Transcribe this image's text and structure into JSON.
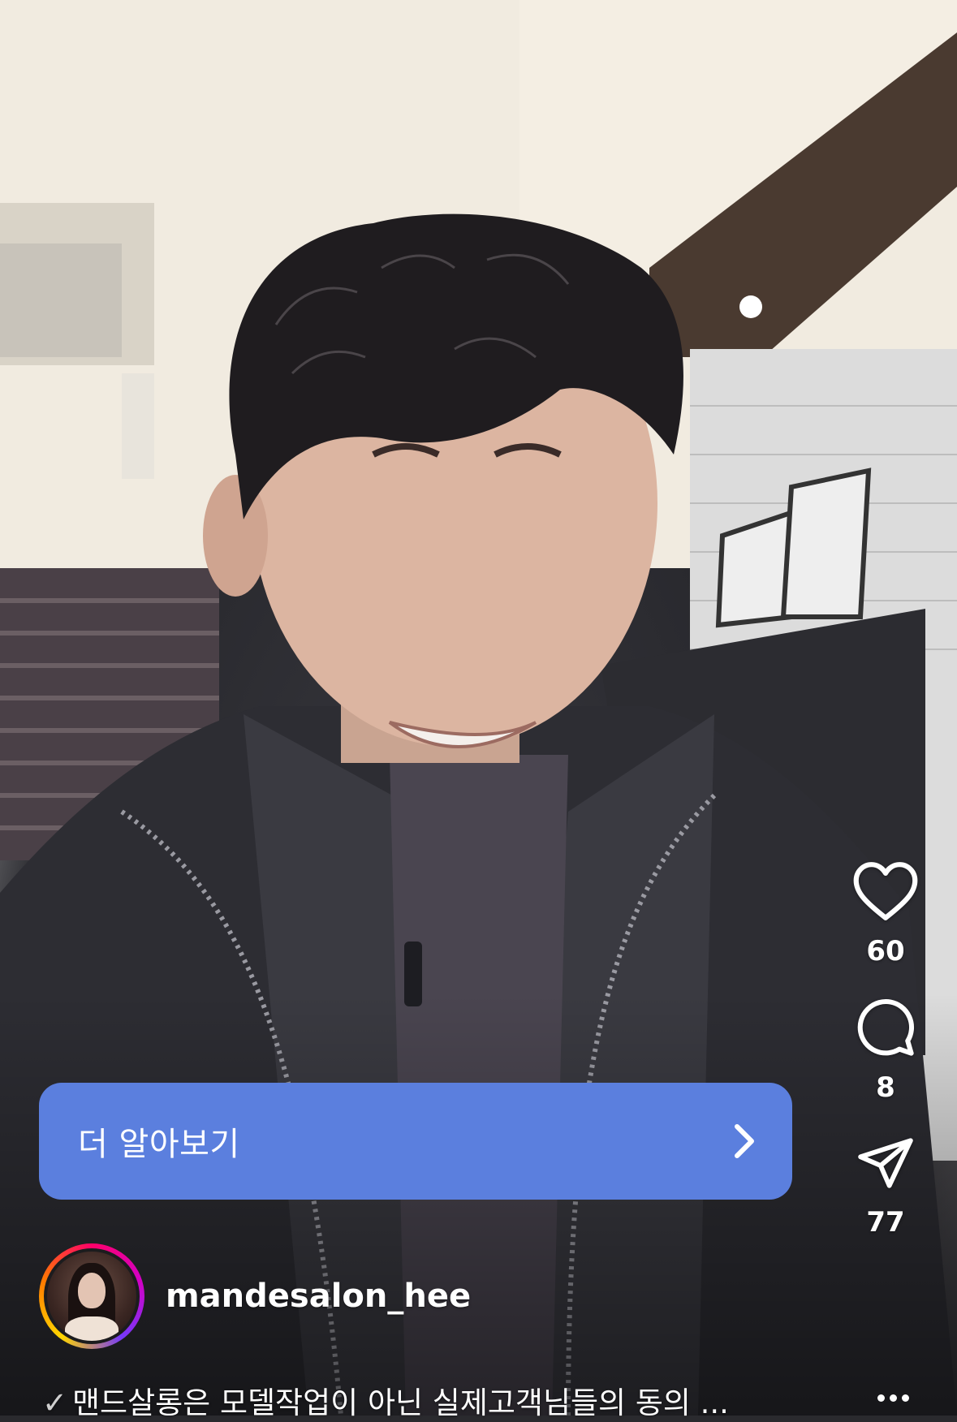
{
  "cta": {
    "label": "더 알아보기",
    "icon": "chevron-right-icon",
    "color": "#5b7fde"
  },
  "actions": {
    "like": {
      "icon": "heart-icon",
      "count": "60"
    },
    "comment": {
      "icon": "comment-icon",
      "count": "8"
    },
    "share": {
      "icon": "send-icon",
      "count": "77"
    },
    "more": {
      "icon": "more-icon"
    }
  },
  "author": {
    "username": "mandesalon_hee",
    "avatar_icon": "avatar"
  },
  "caption": {
    "check": "✓",
    "text": "맨드살롱은 모델작업이 아닌 실제고객님들의 동의 ..."
  }
}
